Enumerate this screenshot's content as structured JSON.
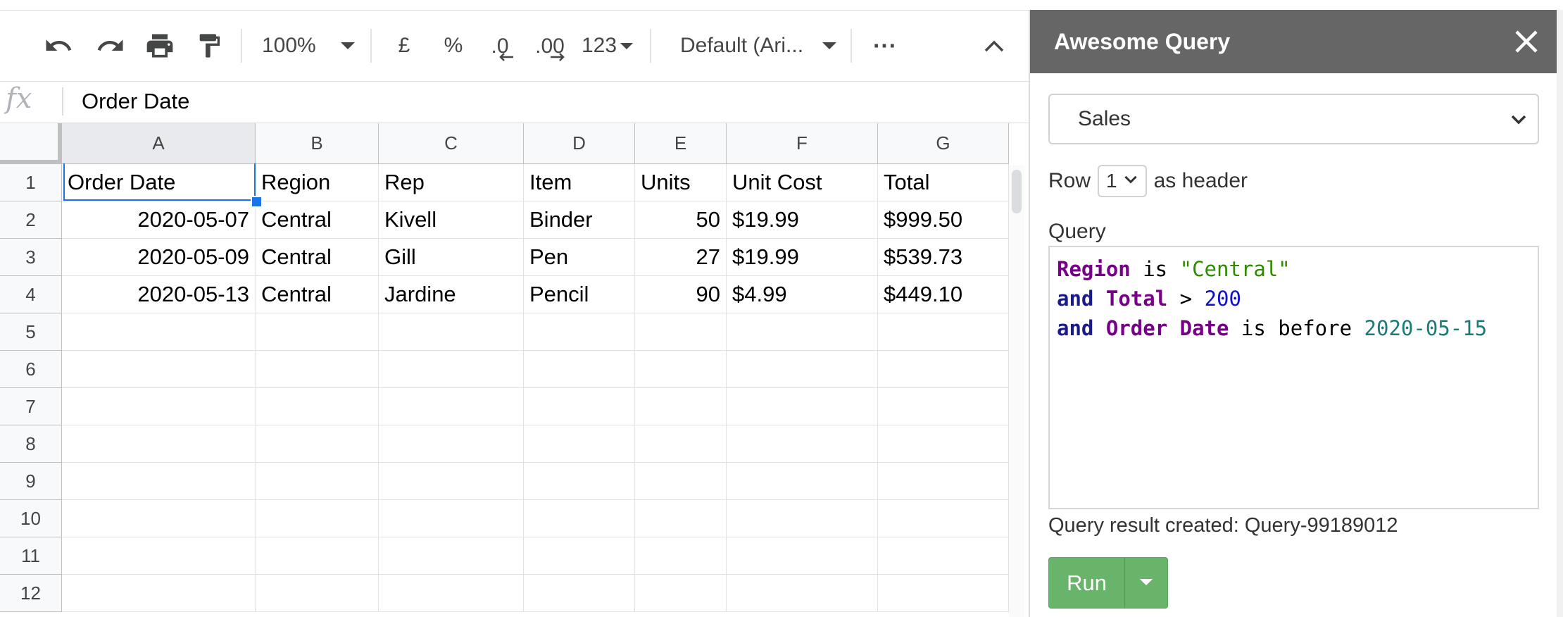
{
  "toolbar": {
    "zoom": "100%",
    "currency": "£",
    "percent": "%",
    "decrease_decimal": ".0",
    "increase_decimal": ".00",
    "more_formats": "123",
    "font": "Default (Ari...",
    "more": "⋯"
  },
  "formula_bar": {
    "fx": "fx",
    "value": "Order Date"
  },
  "grid": {
    "columns": [
      "A",
      "B",
      "C",
      "D",
      "E",
      "F",
      "G"
    ],
    "row_numbers": [
      "1",
      "2",
      "3",
      "4",
      "5",
      "6",
      "7",
      "8",
      "9",
      "10",
      "11",
      "12"
    ],
    "rows": [
      [
        "Order Date",
        "Region",
        "Rep",
        "Item",
        "Units",
        "Unit Cost",
        "Total"
      ],
      [
        "2020-05-07",
        "Central",
        "Kivell",
        "Binder",
        "50",
        "$19.99",
        "$999.50"
      ],
      [
        "2020-05-09",
        "Central",
        "Gill",
        "Pen",
        "27",
        "$19.99",
        "$539.73"
      ],
      [
        "2020-05-13",
        "Central",
        "Jardine",
        "Pencil",
        "90",
        "$4.99",
        "$449.10"
      ]
    ]
  },
  "panel": {
    "title": "Awesome Query",
    "sheet": "Sales",
    "row_label": "Row",
    "header_row": "1",
    "as_header": "as header",
    "query_label": "Query",
    "query": {
      "l1_field": "Region",
      "l1_op": " is ",
      "l1_value": "\"Central\"",
      "l2_kw": "and",
      "l2_field": "Total",
      "l2_op": " > ",
      "l2_value": "200",
      "l3_kw": "and",
      "l3_field": "Order Date",
      "l3_op": " is before ",
      "l3_value": "2020-05-15"
    },
    "result": "Query result created: Query-99189012",
    "run": "Run"
  }
}
